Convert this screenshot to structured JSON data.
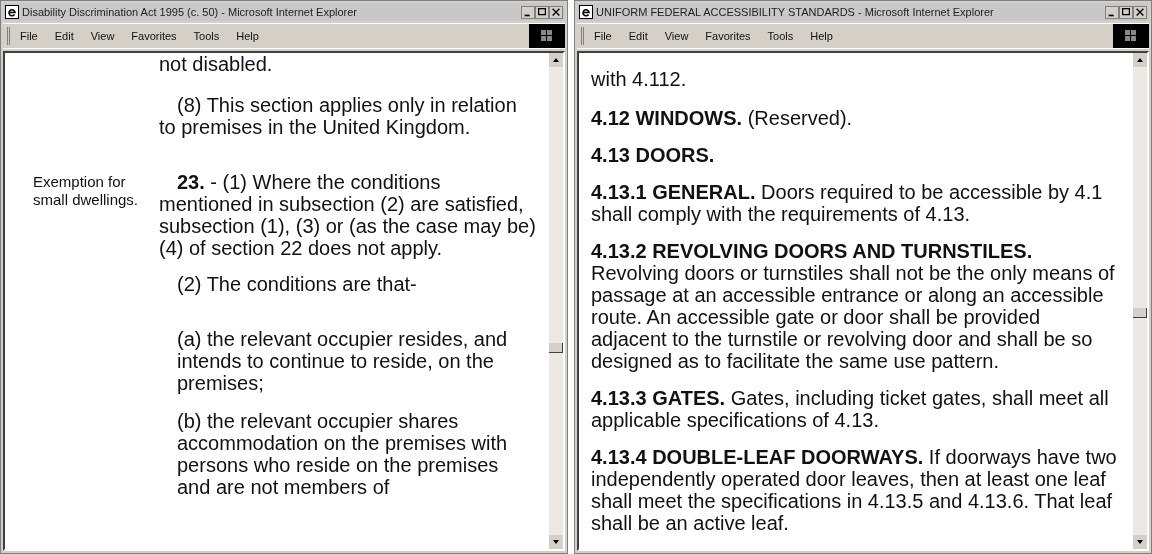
{
  "windows": [
    {
      "title": "Disability Discrimination Act 1995 (c. 50) - Microsoft Internet Explorer",
      "menu": [
        "File",
        "Edit",
        "View",
        "Favorites",
        "Tools",
        "Help"
      ],
      "kind": "statute",
      "blocks": [
        {
          "kind": "continuation",
          "text": "not disabled."
        },
        {
          "kind": "clause",
          "text": "(8) This section applies only in relation to premises in the United Kingdom."
        },
        {
          "kind": "section",
          "margin_note": "Exemption for small dwellings.",
          "text": "**23.** - (1) Where the conditions mentioned in subsection (2) are satisfied, subsection (1), (3) or (as the case may be) (4) of section 22 does not apply."
        },
        {
          "kind": "clause",
          "text": "(2) The conditions are that-"
        },
        {
          "kind": "item",
          "text": "(a) the relevant occupier resides, and intends to continue to reside, on the premises;"
        },
        {
          "kind": "item",
          "text": "(b) the relevant occupier shares accommodation on the premises with persons who reside on the premises and are not members of"
        }
      ]
    },
    {
      "title": "UNIFORM FEDERAL ACCESSIBILITY STANDARDS - Microsoft Internet Explorer",
      "menu": [
        "File",
        "Edit",
        "View",
        "Favorites",
        "Tools",
        "Help"
      ],
      "kind": "standard",
      "blocks": [
        {
          "kind": "continuation",
          "text": "with 4.112."
        },
        {
          "kind": "para",
          "text": "**4.12 WINDOWS.** (Reserved)."
        },
        {
          "kind": "para",
          "text": "**4.13 DOORS.**"
        },
        {
          "kind": "para",
          "text": "**4.13.1 GENERAL.** Doors required to be accessible by 4.1 shall comply with the requirements of 4.13."
        },
        {
          "kind": "para",
          "text": "**4.13.2 REVOLVING DOORS AND TURNSTILES.** Revolving doors or turnstiles shall not be the only means of passage at an accessible entrance or along an accessible route. An accessible gate or door shall be provided adjacent to the turnstile or revolving door and shall be so designed as to facilitate the same use pattern."
        },
        {
          "kind": "para",
          "text": "**4.13.3 GATES.** Gates, including ticket gates, shall meet all applicable specifications of 4.13."
        },
        {
          "kind": "para",
          "text": "**4.13.4 DOUBLE-LEAF DOORWAYS.** If doorways have two independently operated door leaves, then at least one leaf shall meet the specifications in 4.13.5 and 4.13.6. That leaf shall be an active leaf."
        }
      ]
    }
  ]
}
